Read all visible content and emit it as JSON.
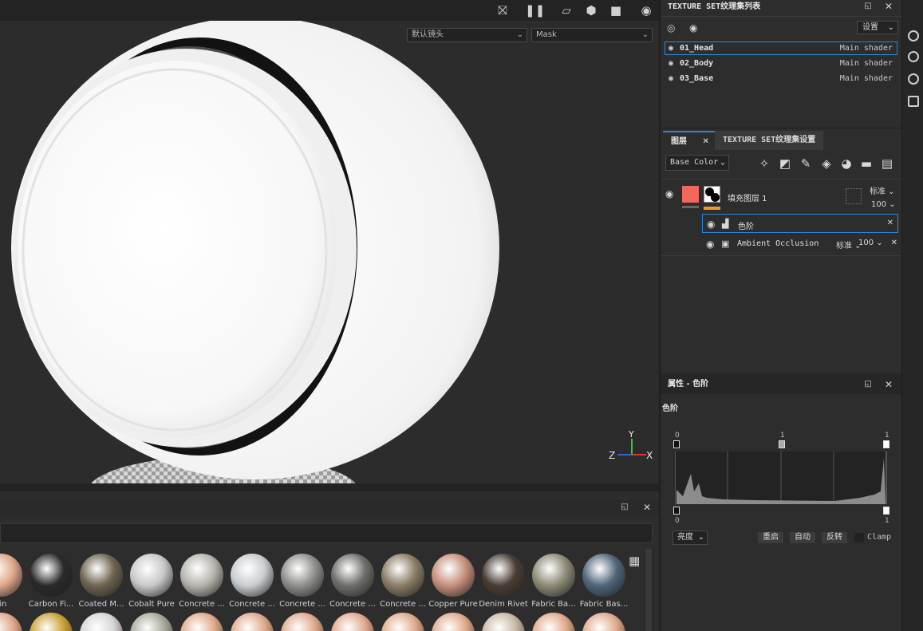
{
  "viewport": {
    "camera_select": "默认镜头",
    "channel_select": "Mask",
    "axis_labels": {
      "y": "Y",
      "z": "Z",
      "x": "X"
    }
  },
  "texture_set_list": {
    "title": "TEXTURE SET纹理集列表",
    "settings_label": "设置",
    "items": [
      {
        "name": "01_Head",
        "shader": "Main shader",
        "selected": true
      },
      {
        "name": "02_Body",
        "shader": "Main shader",
        "selected": false
      },
      {
        "name": "03_Base",
        "shader": "Main shader",
        "selected": false
      }
    ]
  },
  "layers_panel": {
    "tab_layers": "图层",
    "tab_settings": "TEXTURE SET纹理集设置",
    "channel_select": "Base Color",
    "fill_layer": {
      "name": "填充图层 1",
      "blend": "标准",
      "opacity": "100"
    },
    "effects": [
      {
        "name": "色阶",
        "selected": true,
        "blend": "",
        "opacity": ""
      },
      {
        "name": "Ambient Occlusion",
        "selected": false,
        "blend": "标准",
        "opacity": "100"
      }
    ]
  },
  "properties": {
    "title": "属性 - 色阶",
    "section": "色阶",
    "input_top": {
      "left": "0",
      "mid": "1",
      "right": "1"
    },
    "output_bottom": {
      "left": "0",
      "right": "1"
    },
    "mode_select": "亮度",
    "reset_label": "重启",
    "auto_label": "自动",
    "invert_label": "反转",
    "clamp_label": "Clamp"
  },
  "shelf": {
    "materials_row1": [
      {
        "label": "kin",
        "color": "#e0a98c"
      },
      {
        "label": "Carbon Fi...",
        "color": "#2a2a2a"
      },
      {
        "label": "Coated M...",
        "color": "#6d6450"
      },
      {
        "label": "Cobalt Pure",
        "color": "#c8c8c8"
      },
      {
        "label": "Concrete ...",
        "color": "#b7b4ae"
      },
      {
        "label": "Concrete ...",
        "color": "#c9cdd0"
      },
      {
        "label": "Concrete ...",
        "color": "#8f8f8d"
      },
      {
        "label": "Concrete ...",
        "color": "#6e6e6c"
      },
      {
        "label": "Concrete ...",
        "color": "#8b7c66"
      },
      {
        "label": "Copper Pure",
        "color": "#c58f7a"
      },
      {
        "label": "Denim Rivet",
        "color": "#4a3d33"
      },
      {
        "label": "Fabric Ba...",
        "color": "#8d8a76"
      },
      {
        "label": "Fabric Bas...",
        "color": "#4f6679"
      }
    ]
  }
}
